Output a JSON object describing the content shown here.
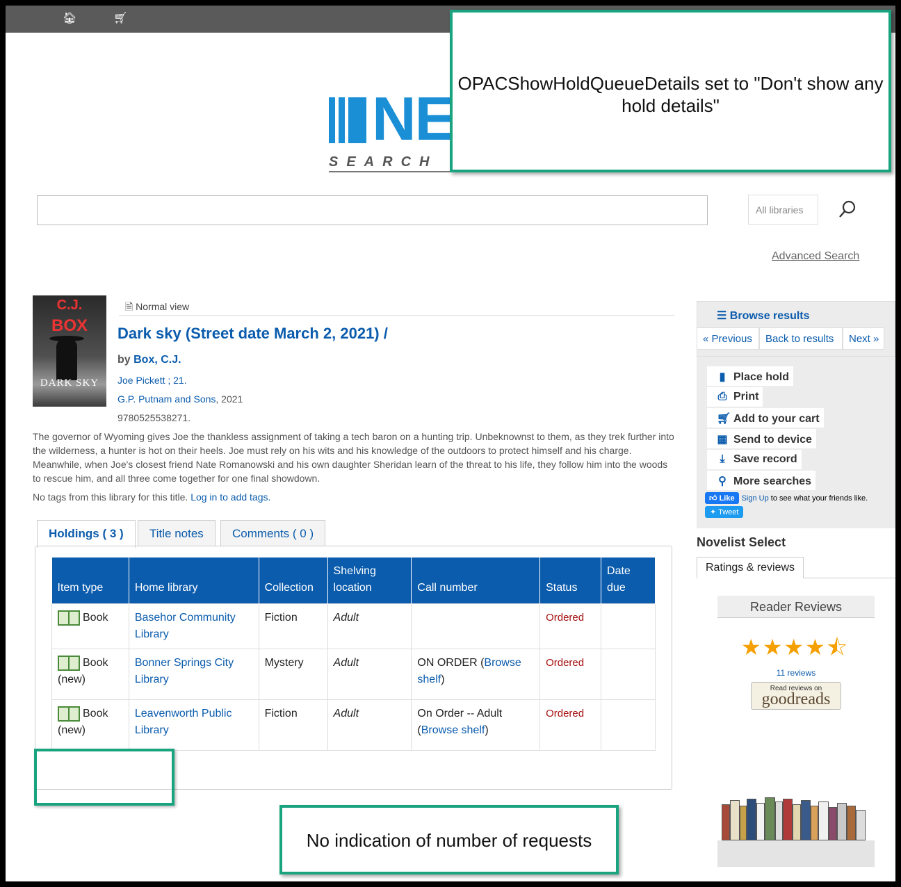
{
  "topbar": {
    "home_icon": "home-icon",
    "cart_icon": "cart-icon"
  },
  "logo": {
    "text": "NE",
    "sub": "SEARCH"
  },
  "search": {
    "library_select": "All libraries",
    "advanced_link": "Advanced Search"
  },
  "record": {
    "cover": {
      "line1": "C.J.",
      "line2": "BOX",
      "line3": "DARK SKY"
    },
    "normal_view": "Normal view",
    "title": "Dark sky (Street date March 2, 2021) /",
    "by_prefix": "by",
    "author": "Box, C.J.",
    "series": "Joe Pickett ; 21.",
    "publisher": "G.P. Putnam and Sons",
    "year": ", 2021",
    "isbn": "9780525538271.",
    "abstract": "The governor of Wyoming gives Joe the thankless assignment of taking a tech baron on a hunting trip. Unbeknownst to them, as they trek further into the wilderness, a hunter is hot on their heels. Joe must rely on his wits and his knowledge of the outdoors to protect himself and his charge. Meanwhile, when Joe's closest friend Nate Romanowski and his own daughter Sheridan learn of the threat to his life, they follow him into the woods to rescue him, and all three come together for one final showdown.",
    "tags_text": "No tags from this library for this title.",
    "tags_link": "Log in to add tags."
  },
  "tabs": [
    {
      "label": "Holdings ( 3 )"
    },
    {
      "label": "Title notes"
    },
    {
      "label": "Comments ( 0 )"
    }
  ],
  "holdings": {
    "headers": [
      "Item type",
      "Home library",
      "Collection",
      "Shelving location",
      "Call number",
      "Status",
      "Date due"
    ],
    "rows": [
      {
        "item_type": "Book",
        "home_library": "Basehor Community Library",
        "collection": "Fiction",
        "location": "Adult",
        "call_prefix": "",
        "call_link": "",
        "call_suffix": "",
        "status": "Ordered",
        "due": ""
      },
      {
        "item_type": "Book (new)",
        "home_library": "Bonner Springs City Library",
        "collection": "Mystery",
        "location": "Adult",
        "call_prefix": "ON ORDER (",
        "call_link": "Browse shelf",
        "call_suffix": ")",
        "status": "Ordered",
        "due": ""
      },
      {
        "item_type": "Book (new)",
        "home_library": "Leavenworth Public Library",
        "collection": "Fiction",
        "location": "Adult",
        "call_prefix": "On Order -- Adult (",
        "call_link": "Browse shelf",
        "call_suffix": ")",
        "status": "Ordered",
        "due": ""
      }
    ]
  },
  "sidebar": {
    "browse": "Browse results",
    "prev": "« Previous",
    "back": "Back to results",
    "next": "Next »",
    "actions": [
      {
        "label": "Place hold",
        "icon": "bookmark-icon"
      },
      {
        "label": "Print",
        "icon": "print-icon"
      },
      {
        "label": "Add to your cart",
        "icon": "cart-icon"
      },
      {
        "label": "Send to device",
        "icon": "qr-code-icon"
      },
      {
        "label": "Save record",
        "icon": "download-icon"
      },
      {
        "label": "More searches",
        "icon": "search-icon"
      }
    ],
    "fb_like": "Like",
    "fb_signup": "Sign Up",
    "fb_text": " to see what your friends like.",
    "tweet": "Tweet"
  },
  "novelist": {
    "heading": "Novelist Select",
    "tab": "Ratings & reviews",
    "reader_reviews": "Reader Reviews",
    "rating": 4.5,
    "review_count": "11 reviews",
    "goodreads_small": "Read reviews on",
    "goodreads": "goodreads"
  },
  "annotations": {
    "top": "OPACShowHoldQueueDetails set to \"Don't show any hold details\"",
    "bottom": "No indication of number of requests"
  },
  "colors": {
    "accent": "#0b5cad",
    "annotation_border": "#1aa37f",
    "status_ordered": "#a41010"
  }
}
